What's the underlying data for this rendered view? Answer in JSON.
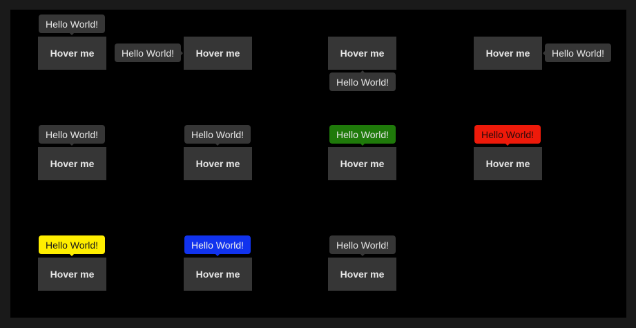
{
  "buttons": {
    "label": "Hover me"
  },
  "tooltips": {
    "text": "Hello World!"
  },
  "colors": {
    "default_bg": "#363636",
    "default_text": "#e6e6e6",
    "green_bg": "#1f7a0a",
    "red_bg": "#ee1a0a",
    "yellow_bg": "#ffee00",
    "blue_bg": "#1133ee",
    "page_bg": "#000000",
    "frame_bg": "#1a1a1a"
  }
}
